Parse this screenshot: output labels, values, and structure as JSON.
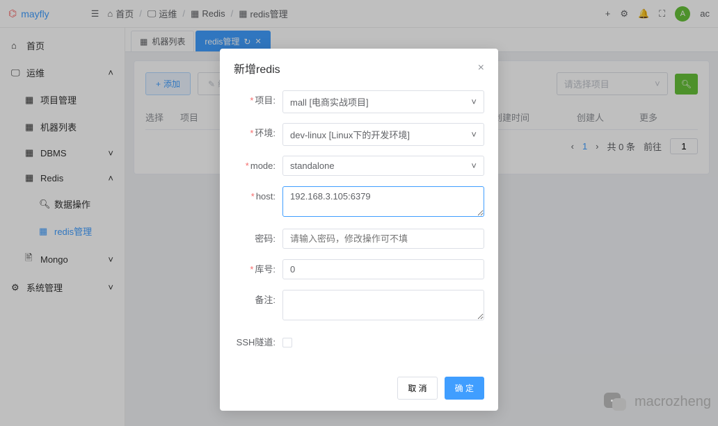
{
  "brand": "mayfly",
  "breadcrumb": [
    "首页",
    "运维",
    "Redis",
    "redis管理"
  ],
  "user_initial": "A",
  "user_name_partial": "ac",
  "sidebar": {
    "home": "首页",
    "ops": "运维",
    "ops_children": {
      "project_mgmt": "项目管理",
      "machine_list": "机器列表",
      "dbms": "DBMS",
      "redis": "Redis",
      "redis_children": {
        "data_ops": "数据操作",
        "redis_mgmt": "redis管理"
      },
      "mongo": "Mongo"
    },
    "sysmgmt": "系统管理"
  },
  "tabs": [
    {
      "label": "机器列表",
      "active": false
    },
    {
      "label": "redis管理",
      "active": true,
      "refresh": true
    }
  ],
  "toolbar": {
    "add": "添加",
    "edit": "编辑",
    "project_select_placeholder": "请选择项目"
  },
  "table_columns": {
    "select": "选择",
    "project": "项目",
    "create_time": "创建时间",
    "creator": "创建人",
    "more": "更多"
  },
  "pagination": {
    "current": "1",
    "total_text": "共 0 条",
    "goto": "前往",
    "page_input": "1"
  },
  "dialog": {
    "title": "新增redis",
    "labels": {
      "project": "项目:",
      "env": "环境:",
      "mode": "mode:",
      "host": "host:",
      "password": "密码:",
      "db": "库号:",
      "remark": "备注:",
      "ssh": "SSH隧道:"
    },
    "values": {
      "project": "mall [电商实战项目]",
      "env": "dev-linux [Linux下的开发环境]",
      "mode": "standalone",
      "host": "192.168.3.105:6379",
      "password_placeholder": "请输入密码，修改操作可不填",
      "db": "0",
      "remark": ""
    },
    "buttons": {
      "cancel": "取 消",
      "confirm": "确 定"
    }
  },
  "watermark": "macrozheng"
}
